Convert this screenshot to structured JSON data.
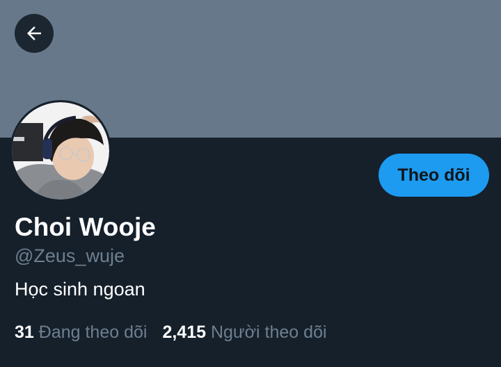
{
  "profile": {
    "display_name": "Choi Wooje",
    "handle": "@Zeus_wuje",
    "bio": "Học sinh ngoan"
  },
  "actions": {
    "follow_label": "Theo dõi",
    "back_icon": "arrow-left-icon"
  },
  "stats": {
    "following_count": "31",
    "following_label": "Đang theo dõi",
    "followers_count": "2,415",
    "followers_label": "Người theo dõi"
  },
  "colors": {
    "background": "#15202b",
    "banner": "#66788a",
    "accent": "#1d9bf0",
    "muted_text": "#6e7f8f"
  }
}
